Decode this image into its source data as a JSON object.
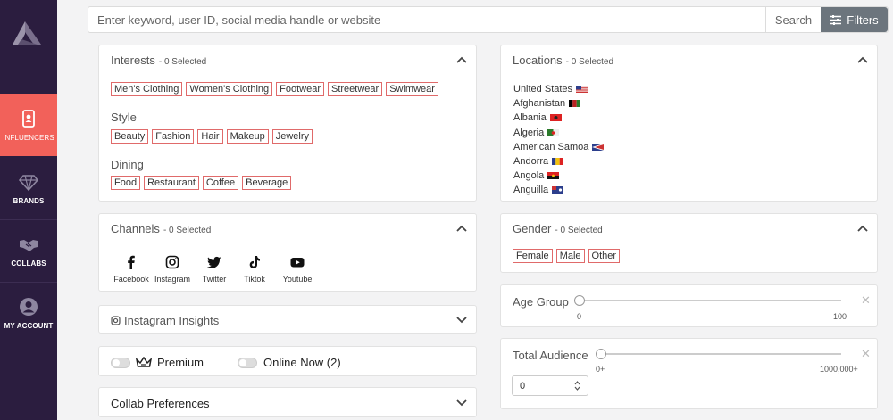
{
  "sidebar": {
    "logo_icon": "brand-logo-icon",
    "items": [
      {
        "label": "INFLUENCERS",
        "icon": "id-badge-icon",
        "active": true
      },
      {
        "label": "BRANDS",
        "icon": "diamond-icon",
        "active": false
      },
      {
        "label": "COLLABS",
        "icon": "handshake-icon",
        "active": false
      },
      {
        "label": "MY ACCOUNT",
        "icon": "user-circle-icon",
        "active": false
      }
    ]
  },
  "search": {
    "placeholder": "Enter keyword, user ID, social media handle or website",
    "value": "",
    "search_label": "Search",
    "filters_label": "Filters"
  },
  "interests": {
    "title": "Interests",
    "selected": "- 0 Selected",
    "tags": [
      "Men's Clothing",
      "Women's Clothing",
      "Footwear",
      "Streetwear",
      "Swimwear"
    ],
    "style": {
      "title": "Style",
      "tags": [
        "Beauty",
        "Fashion",
        "Hair",
        "Makeup",
        "Jewelry"
      ]
    },
    "dining": {
      "title": "Dining",
      "tags": [
        "Food",
        "Restaurant",
        "Coffee",
        "Beverage"
      ]
    }
  },
  "locations": {
    "title": "Locations",
    "selected": "- 0 Selected",
    "items": [
      "United States",
      "Afghanistan",
      "Albania",
      "Algeria",
      "American Samoa",
      "Andorra",
      "Angola",
      "Anguilla"
    ]
  },
  "channels": {
    "title": "Channels",
    "selected": "- 0 Selected",
    "items": [
      {
        "label": "Facebook",
        "icon": "facebook-icon"
      },
      {
        "label": "Instagram",
        "icon": "instagram-icon"
      },
      {
        "label": "Twitter",
        "icon": "twitter-icon"
      },
      {
        "label": "Tiktok",
        "icon": "tiktok-icon"
      },
      {
        "label": "Youtube",
        "icon": "youtube-icon"
      }
    ]
  },
  "gender": {
    "title": "Gender",
    "selected": "- 0 Selected",
    "tags": [
      "Female",
      "Male",
      "Other"
    ]
  },
  "instagram_insights": {
    "title": "Instagram Insights"
  },
  "age_group": {
    "title": "Age Group",
    "min": "0",
    "max": "100",
    "value": 0
  },
  "toggles": {
    "premium": "Premium",
    "online_now": "Online Now (2)"
  },
  "total_audience": {
    "title": "Total Audience",
    "min": "0+",
    "max": "1000,000+",
    "input_value": "0",
    "value": 0
  },
  "collab_preferences": {
    "title": "Collab Preferences"
  },
  "colors": {
    "sidebar": "#2b1d3f",
    "active": "#f2615a",
    "tag_border": "#e06a6a",
    "filters_bg": "#6c757d"
  }
}
